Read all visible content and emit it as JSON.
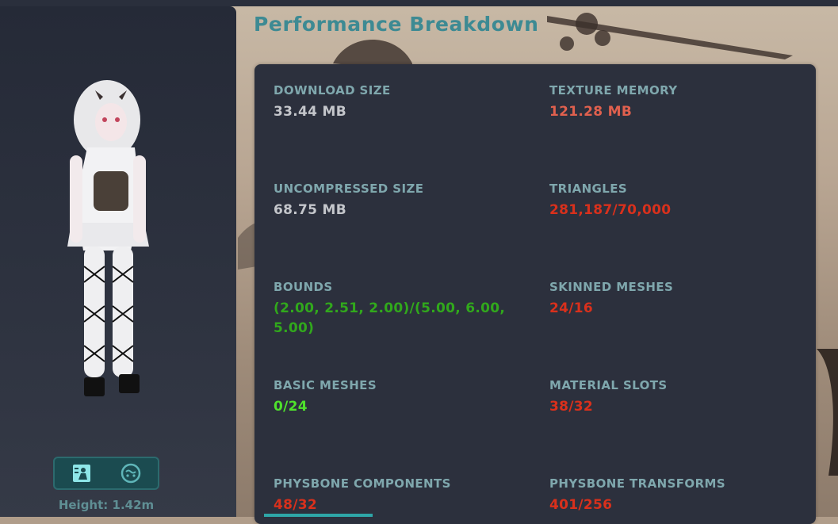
{
  "title": "Performance Breakdown",
  "avatar": {
    "height_label": "Height: 1.42m",
    "toggle_buttons": [
      {
        "icon": "avatar-details-icon",
        "selected": true
      },
      {
        "icon": "face-icon",
        "selected": false
      }
    ]
  },
  "stats": [
    {
      "label": "DOWNLOAD SIZE",
      "value": "33.44 MB",
      "status": "neutral"
    },
    {
      "label": "TEXTURE MEMORY",
      "value": "121.28 MB",
      "status": "warning"
    },
    {
      "label": "UNCOMPRESSED SIZE",
      "value": "68.75 MB",
      "status": "neutral"
    },
    {
      "label": "TRIANGLES",
      "value": "281,187/70,000",
      "status": "very-poor"
    },
    {
      "label": "BOUNDS",
      "value": "(2.00, 2.51, 2.00)/(5.00, 6.00, 5.00)",
      "status": "good"
    },
    {
      "label": "SKINNED MESHES",
      "value": "24/16",
      "status": "very-poor"
    },
    {
      "label": "BASIC MESHES",
      "value": "0/24",
      "status": "excellent"
    },
    {
      "label": "MATERIAL SLOTS",
      "value": "38/32",
      "status": "very-poor"
    },
    {
      "label": "PHYSBONE COMPONENTS",
      "value": "48/32",
      "status": "very-poor"
    },
    {
      "label": "PHYSBONE TRANSFORMS",
      "value": "401/256",
      "status": "very-poor"
    }
  ],
  "colors": {
    "title": "#3d8a93",
    "label": "#7fa7ad",
    "neutral": "#c4c6cb",
    "warning": "#e0604e",
    "very_poor": "#d9301c",
    "good": "#31a81c",
    "excellent": "#4fe12c",
    "accent": "#2ea6a8"
  }
}
